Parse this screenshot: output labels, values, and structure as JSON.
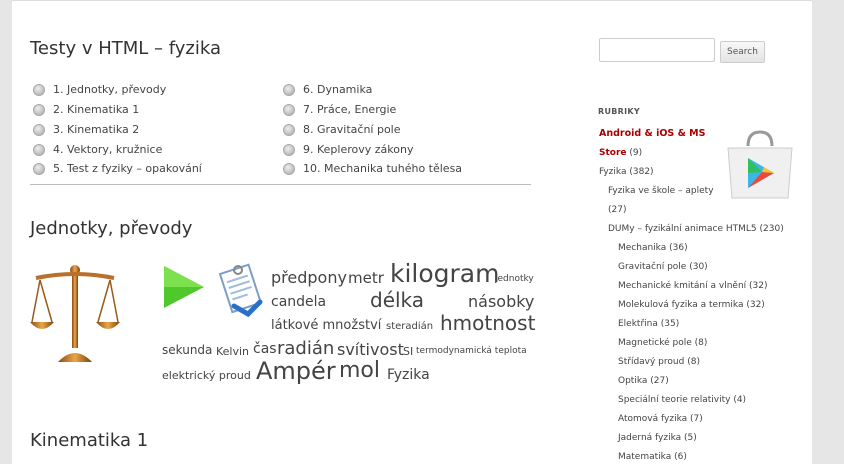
{
  "page_title": "Testy v HTML – fyzika",
  "tests": [
    {
      "label": "1. Jednotky, převody"
    },
    {
      "label": "2. Kinematika 1"
    },
    {
      "label": "3. Kinematika 2"
    },
    {
      "label": "4. Vektory, kružnice"
    },
    {
      "label": "5. Test z fyziky – opakování"
    },
    {
      "label": "6. Dynamika"
    },
    {
      "label": "7. Práce, Energie"
    },
    {
      "label": "8. Gravitační pole"
    },
    {
      "label": "9. Keplerovy zákony"
    },
    {
      "label": "10. Mechanika tuhého tělesa"
    }
  ],
  "section1_title": "Jednotky, převody",
  "section2_title": "Kinematika 1",
  "tag_cloud": [
    {
      "text": "předpony"
    },
    {
      "text": "metr"
    },
    {
      "text": "kilogram"
    },
    {
      "text": "jednotky"
    },
    {
      "text": "candela"
    },
    {
      "text": "délka"
    },
    {
      "text": "násobky"
    },
    {
      "text": "látkové množství"
    },
    {
      "text": "steradián"
    },
    {
      "text": "hmotnost"
    },
    {
      "text": "sekunda"
    },
    {
      "text": "Kelvin"
    },
    {
      "text": "čas"
    },
    {
      "text": "radián"
    },
    {
      "text": "svítivost"
    },
    {
      "text": "SI"
    },
    {
      "text": "termodynamická teplota"
    },
    {
      "text": "elektrický proud"
    },
    {
      "text": "Ampér"
    },
    {
      "text": "mol"
    },
    {
      "text": "Fyzika"
    }
  ],
  "search": {
    "button_label": "Search",
    "placeholder": ""
  },
  "sidebar": {
    "heading": "RUBRIKY",
    "categories": [
      {
        "line1": "Android & iOS & MS",
        "line2": "Store",
        "count": "(9)"
      },
      {
        "label": "Fyzika",
        "count": "(382)"
      },
      {
        "label": "Fyzika ve škole – aplety",
        "count": "(27)"
      },
      {
        "label": "DUMy – fyzikální animace HTML5",
        "count": "(230)"
      },
      {
        "label": "Mechanika",
        "count": "(36)"
      },
      {
        "label": "Gravitační pole",
        "count": "(30)"
      },
      {
        "label": "Mechanické kmitání a vlnění",
        "count": "(32)"
      },
      {
        "label": "Molekulová fyzika a termika",
        "count": "(32)"
      },
      {
        "label": "Elektřina",
        "count": "(35)"
      },
      {
        "label": "Magnetické pole",
        "count": "(8)"
      },
      {
        "label": "Střídavý proud",
        "count": "(8)"
      },
      {
        "label": "Optika",
        "count": "(27)"
      },
      {
        "label": "Speciální teorie relativity",
        "count": "(4)"
      },
      {
        "label": "Atomová fyzika",
        "count": "(7)"
      },
      {
        "label": "Jaderná fyzika",
        "count": "(5)"
      },
      {
        "label": "Matematika",
        "count": "(6)"
      }
    ]
  }
}
